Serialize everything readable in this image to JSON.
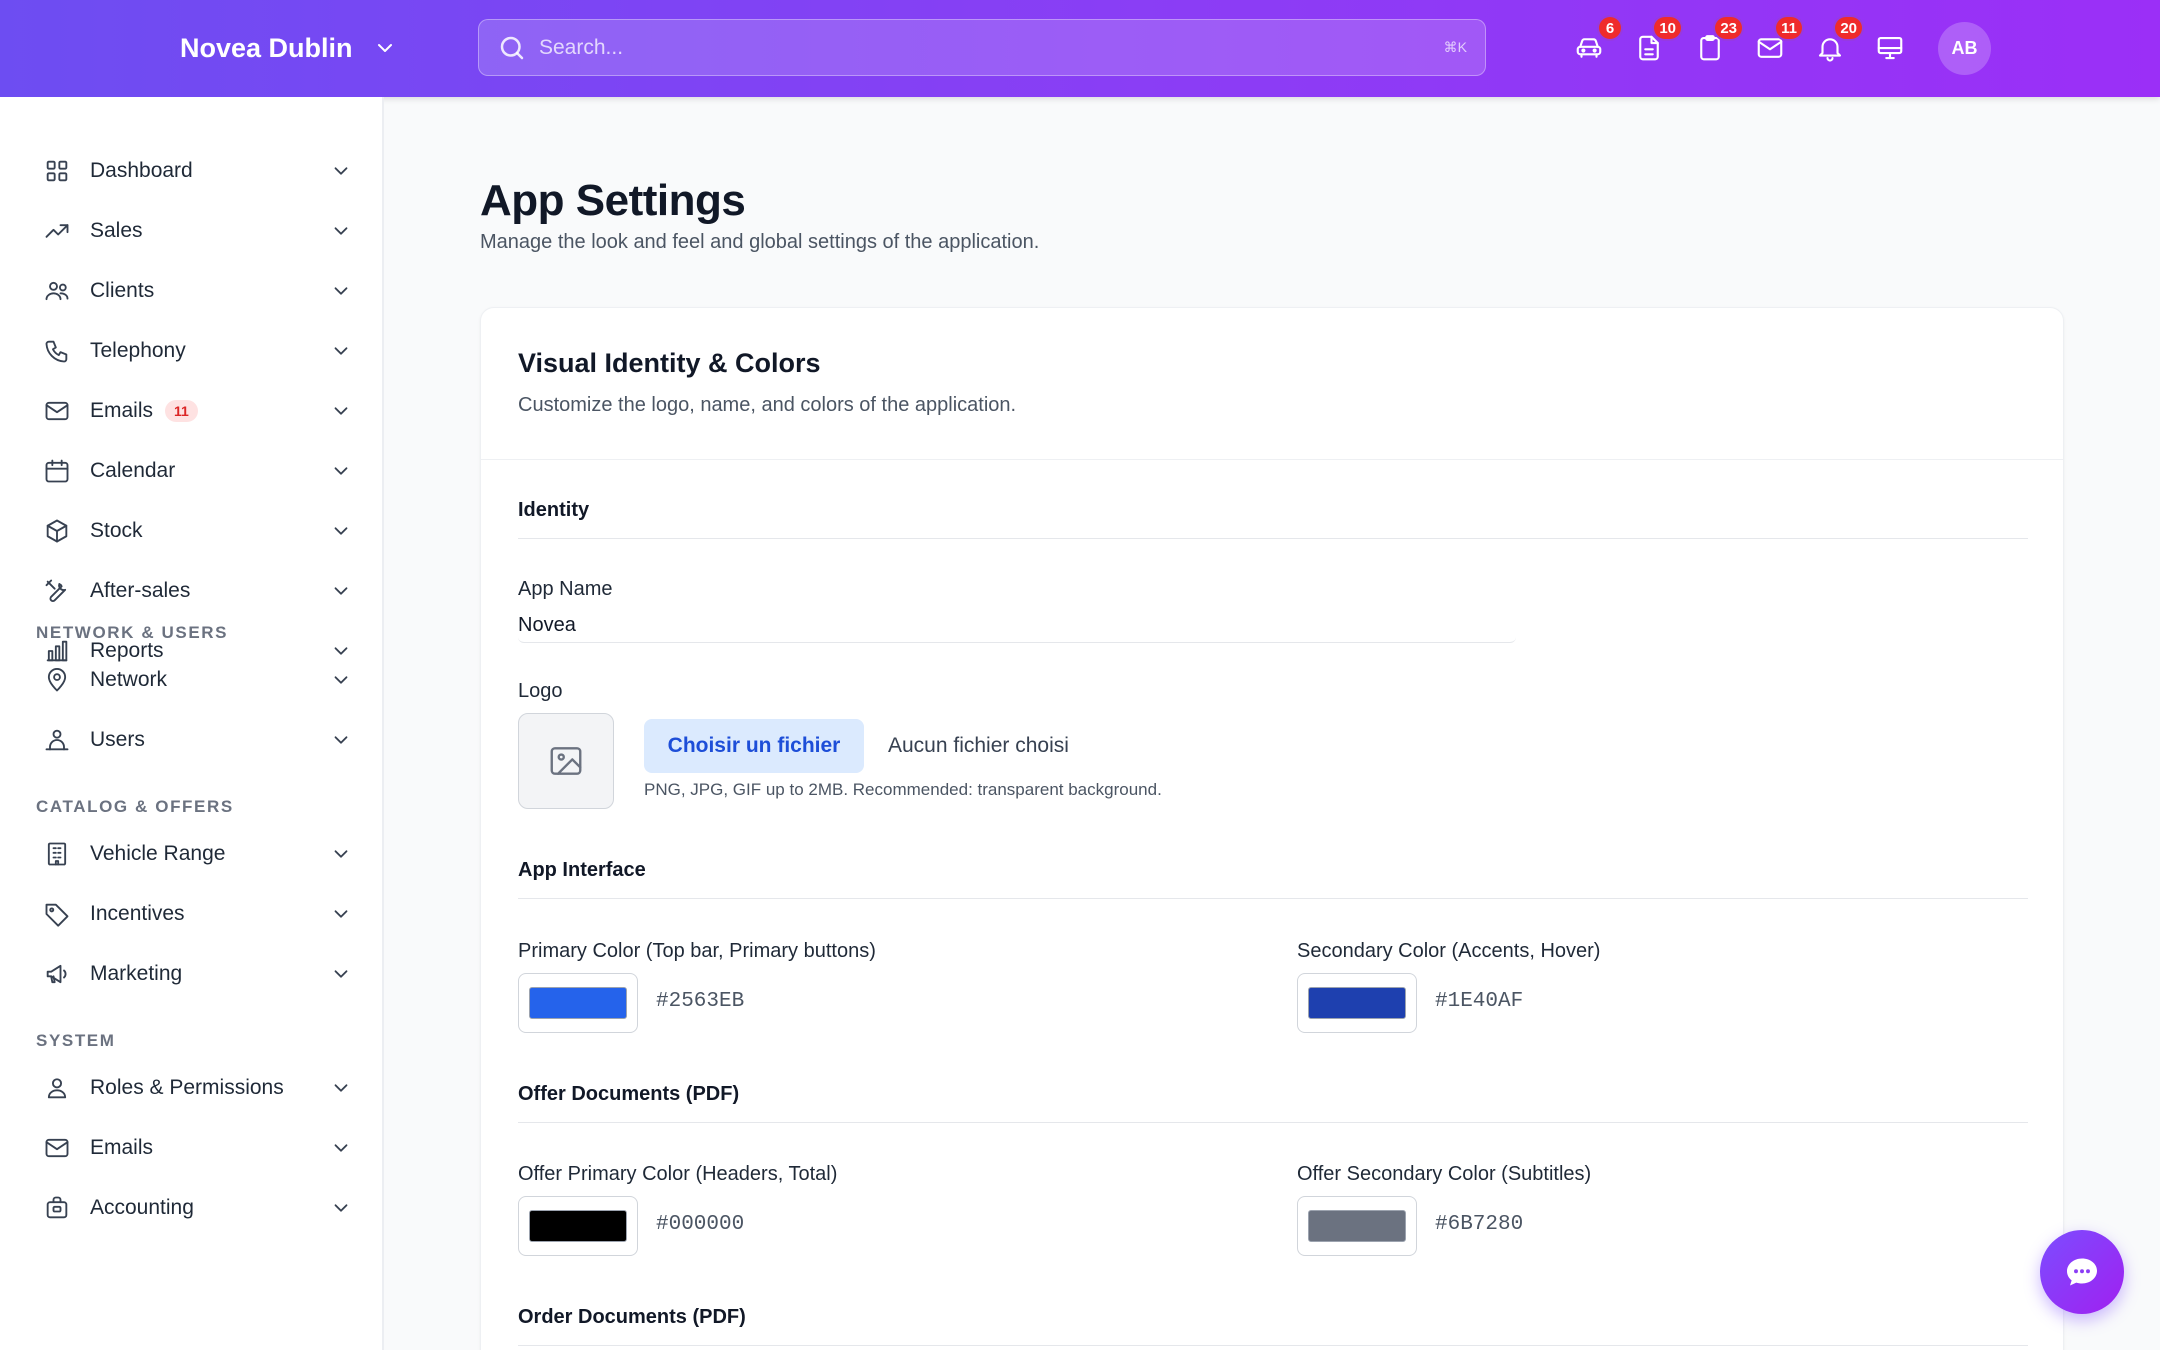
{
  "topbar": {
    "brand": "Novea Dublin",
    "search_placeholder": "Search...",
    "search_shortcut": "⌘K",
    "icons": [
      {
        "name": "car-icon",
        "badge": "6"
      },
      {
        "name": "document-icon",
        "badge": "10"
      },
      {
        "name": "clipboard-icon",
        "badge": "23"
      },
      {
        "name": "mail-icon",
        "badge": "11"
      },
      {
        "name": "bell-icon",
        "badge": "20"
      },
      {
        "name": "monitor-icon",
        "badge": ""
      }
    ],
    "avatar": "AB"
  },
  "sidebar": {
    "items": [
      {
        "label": "Dashboard",
        "icon": "grid-icon"
      },
      {
        "label": "Sales",
        "icon": "trending-up-icon"
      },
      {
        "label": "Clients",
        "icon": "users-icon"
      },
      {
        "label": "Telephony",
        "icon": "phone-icon"
      },
      {
        "label": "Emails",
        "icon": "mail-icon",
        "badge": "11"
      },
      {
        "label": "Calendar",
        "icon": "calendar-icon"
      },
      {
        "label": "Stock",
        "icon": "box-icon"
      },
      {
        "label": "After-sales",
        "icon": "tools-icon"
      },
      {
        "label": "Reports",
        "icon": "bar-chart-icon"
      }
    ],
    "sections": [
      {
        "title": "NETWORK & USERS",
        "items": [
          {
            "label": "Network",
            "icon": "map-pin-icon"
          },
          {
            "label": "Users",
            "icon": "user-group-icon"
          }
        ]
      },
      {
        "title": "CATALOG & OFFERS",
        "items": [
          {
            "label": "Vehicle Range",
            "icon": "building-icon"
          },
          {
            "label": "Incentives",
            "icon": "tag-icon"
          },
          {
            "label": "Marketing",
            "icon": "megaphone-icon"
          }
        ]
      },
      {
        "title": "SYSTEM",
        "items": [
          {
            "label": "Roles & Permissions",
            "icon": "user-icon"
          },
          {
            "label": "Emails",
            "icon": "mail-icon"
          },
          {
            "label": "Accounting",
            "icon": "briefcase-icon"
          }
        ]
      }
    ]
  },
  "main": {
    "title": "App Settings",
    "subtitle": "Manage the look and feel and global settings of the application.",
    "card": {
      "title": "Visual Identity & Colors",
      "subtitle": "Customize the logo, name, and colors of the application.",
      "identity": {
        "section": "Identity",
        "app_name_label": "App Name",
        "app_name_value": "Novea",
        "logo_label": "Logo",
        "file_button": "Choisir un fichier",
        "file_status": "Aucun fichier choisi",
        "file_hint": "PNG, JPG, GIF up to 2MB. Recommended: transparent background."
      },
      "app_interface": {
        "section": "App Interface",
        "primary_label": "Primary Color (Top bar, Primary buttons)",
        "primary_hex": "#2563EB",
        "secondary_label": "Secondary Color (Accents, Hover)",
        "secondary_hex": "#1E40AF"
      },
      "offer_docs": {
        "section": "Offer Documents (PDF)",
        "primary_label": "Offer Primary Color (Headers, Total)",
        "primary_hex": "#000000",
        "secondary_label": "Offer Secondary Color (Subtitles)",
        "secondary_hex": "#6B7280"
      },
      "order_docs": {
        "section": "Order Documents (PDF)"
      }
    }
  },
  "colors": {
    "topbar_start": "#6d4df2",
    "topbar_end": "#9b2ff7",
    "badge": "#ef2b2b"
  }
}
